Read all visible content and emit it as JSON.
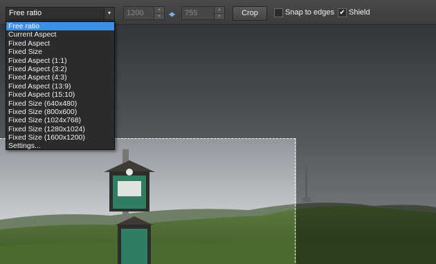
{
  "toolbar": {
    "ratio_value": "Free ratio",
    "width_value": "1200",
    "height_value": "755",
    "crop_label": "Crop",
    "snap_label": "Snap to edges",
    "snap_checked": false,
    "shield_label": "Shield",
    "shield_checked": true
  },
  "dropdown": {
    "items": [
      "Free ratio",
      "Current Aspect",
      "Fixed Aspect",
      "Fixed Size",
      "Fixed Aspect (1:1)",
      "Fixed Aspect (3:2)",
      "Fixed Aspect (4:3)",
      "Fixed Aspect (13:9)",
      "Fixed Aspect (15:10)",
      "Fixed Size (640x480)",
      "Fixed Size (800x600)",
      "Fixed Size (1024x768)",
      "Fixed Size (1280x1024)",
      "Fixed Size (1600x1200)",
      "Settings..."
    ],
    "selected_index": 0
  },
  "colors": {
    "selection": "#3d8ee6",
    "crop_border": "#ffffff"
  },
  "icons": {
    "dropdown_arrow": "chevron-down-icon",
    "swap": "swap-arrows-icon",
    "spin_up": "spin-up-icon",
    "spin_down": "spin-down-icon",
    "check": "check-icon"
  }
}
